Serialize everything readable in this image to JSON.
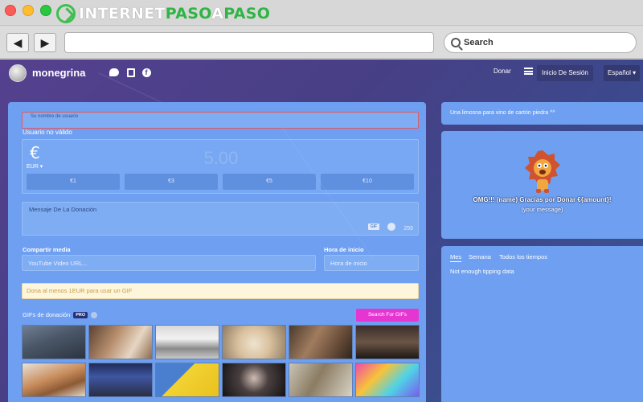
{
  "browser": {
    "logo": {
      "part1": "INTERNET",
      "part2": "PASO",
      "part3": "A",
      "part4": "PASO"
    },
    "search_placeholder": "Search",
    "back_glyph": "◀",
    "forward_glyph": "▶"
  },
  "header": {
    "username": "monegrina",
    "donar": "Donar",
    "login": "Inicio De Sesión",
    "language": "Español ▾"
  },
  "form": {
    "username_placeholder": "Su nombre de usuario",
    "invalid_text": "Usuario no válido",
    "currency_symbol": "€",
    "currency_code": "EUR ▾",
    "amount": "5.00",
    "presets": [
      "€1",
      "€3",
      "€5",
      "€10"
    ],
    "message_placeholder": "Mensaje De La Donación",
    "gif_tag": "GIF",
    "char_count": "255",
    "media_label": "Compartir media",
    "media_placeholder": "YouTube Video URL...",
    "start_label": "Hora de inicio",
    "start_placeholder": "Hora de inicio",
    "gif_note": "Dona al menos 1EUR para usar un GIF",
    "gifs_label": "GIFs de donación",
    "pro_badge": "PRO",
    "search_gifs": "Search For GIFs"
  },
  "sidebar": {
    "tagline": "Una limosna para vino de cartón piedra ^^",
    "alert_text": "OMG!!! (name) Gracias por Donar €{amount}!",
    "alert_message": "(your message)",
    "tabs": [
      "Mes",
      "Semana",
      "Todos los tiempos"
    ],
    "empty_text": "Not enough tipping data"
  },
  "colors": {
    "card": "#6e9ff0",
    "accent_pink": "#e636d2",
    "brand_green": "#2fb544"
  }
}
